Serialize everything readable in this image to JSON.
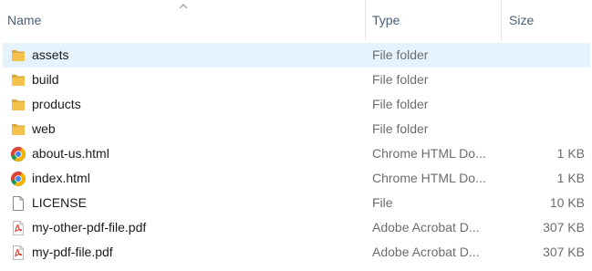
{
  "columns": {
    "name": "Name",
    "type": "Type",
    "size": "Size"
  },
  "files": [
    {
      "name": "assets",
      "type": "File folder",
      "size": "",
      "icon": "folder-icon",
      "selected": true
    },
    {
      "name": "build",
      "type": "File folder",
      "size": "",
      "icon": "folder-icon",
      "selected": false
    },
    {
      "name": "products",
      "type": "File folder",
      "size": "",
      "icon": "folder-icon",
      "selected": false
    },
    {
      "name": "web",
      "type": "File folder",
      "size": "",
      "icon": "folder-icon",
      "selected": false
    },
    {
      "name": "about-us.html",
      "type": "Chrome HTML Do...",
      "size": "1 KB",
      "icon": "chrome-icon",
      "selected": false
    },
    {
      "name": "index.html",
      "type": "Chrome HTML Do...",
      "size": "1 KB",
      "icon": "chrome-icon",
      "selected": false
    },
    {
      "name": "LICENSE",
      "type": "File",
      "size": "10 KB",
      "icon": "blank-file-icon",
      "selected": false
    },
    {
      "name": "my-other-pdf-file.pdf",
      "type": "Adobe Acrobat D...",
      "size": "307 KB",
      "icon": "pdf-icon",
      "selected": false
    },
    {
      "name": "my-pdf-file.pdf",
      "type": "Adobe Acrobat D...",
      "size": "307 KB",
      "icon": "pdf-icon",
      "selected": false
    }
  ],
  "colors": {
    "selection": "#e5f3ff",
    "header_text": "#4c607a",
    "secondary_text": "#6d6d6d",
    "folder": "#f4c14d",
    "pdf": "#d9291c"
  }
}
